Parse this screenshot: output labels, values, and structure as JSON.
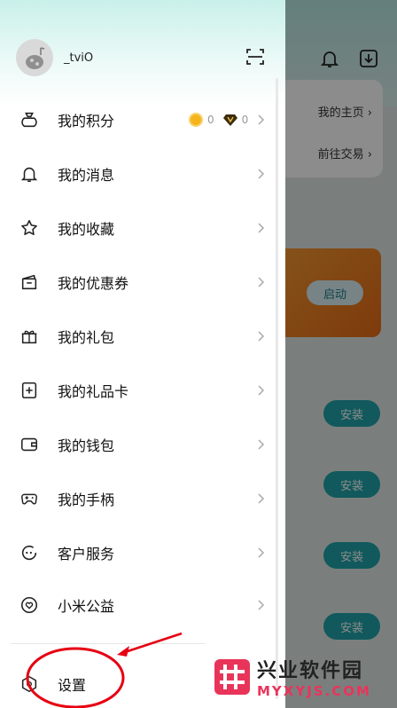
{
  "background": {
    "links": [
      "我的主页 ›",
      "前往交易 ›"
    ],
    "start_label": "启动",
    "install_label": "安装"
  },
  "profile": {
    "username": "_tviO"
  },
  "menu": [
    {
      "label": "我的积分",
      "icon": "points-bag-icon"
    },
    {
      "label": "我的消息",
      "icon": "bell-icon"
    },
    {
      "label": "我的收藏",
      "icon": "star-icon"
    },
    {
      "label": "我的优惠券",
      "icon": "coupon-icon"
    },
    {
      "label": "我的礼包",
      "icon": "gift-icon"
    },
    {
      "label": "我的礼品卡",
      "icon": "gift-card-icon"
    },
    {
      "label": "我的钱包",
      "icon": "wallet-icon"
    },
    {
      "label": "我的手柄",
      "icon": "gamepad-icon"
    },
    {
      "label": "客户服务",
      "icon": "customer-service-icon"
    },
    {
      "label": "小米公益",
      "icon": "charity-heart-icon"
    }
  ],
  "points": {
    "coins": "0",
    "diamonds": "0"
  },
  "settings": {
    "label": "设置"
  },
  "watermark": {
    "cn": "兴业软件园",
    "en": "MYXYJS.COM"
  },
  "colors": {
    "accent": "#1fa3a8",
    "annotation": "#e60012",
    "watermark": "#e9345a"
  }
}
